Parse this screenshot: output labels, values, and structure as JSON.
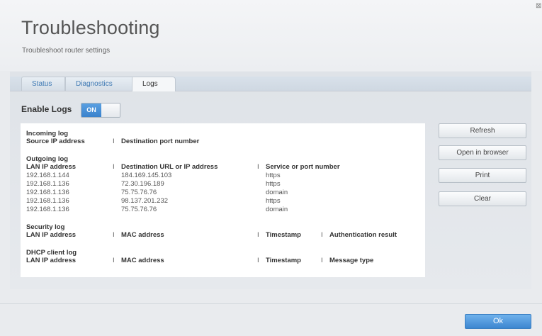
{
  "header": {
    "title": "Troubleshooting",
    "subtitle": "Troubleshoot router settings",
    "close_symbol": "⊠"
  },
  "tabs": [
    {
      "label": "Status"
    },
    {
      "label": "Diagnostics"
    },
    {
      "label": "Logs"
    }
  ],
  "enable_logs": {
    "label": "Enable Logs",
    "state": "ON"
  },
  "logs": {
    "sep": "I",
    "incoming": {
      "title": "Incoming log",
      "headers": [
        "Source IP address",
        "Destination port number"
      ]
    },
    "outgoing": {
      "title": "Outgoing log",
      "headers": [
        "LAN IP address",
        "Destination URL or IP address",
        "Service or port number"
      ],
      "rows": [
        [
          "192.168.1.144",
          "184.169.145.103",
          "https"
        ],
        [
          "192.168.1.136",
          "72.30.196.189",
          "https"
        ],
        [
          "192.168.1.136",
          "75.75.76.76",
          "domain"
        ],
        [
          "192.168.1.136",
          "98.137.201.232",
          "https"
        ],
        [
          "192.168.1.136",
          "75.75.76.76",
          "domain"
        ]
      ]
    },
    "security": {
      "title": "Security log",
      "headers": [
        "LAN IP address",
        "MAC address",
        "Timestamp",
        "Authentication result"
      ]
    },
    "dhcp": {
      "title": "DHCP client log",
      "headers": [
        "LAN IP address",
        "MAC address",
        "Timestamp",
        "Message type"
      ]
    }
  },
  "actions": {
    "refresh": "Refresh",
    "open_browser": "Open in browser",
    "print": "Print",
    "clear": "Clear"
  },
  "footer": {
    "ok": "Ok"
  },
  "colors": {
    "accent": "#3a82cc",
    "tab_link": "#3f7ab4"
  }
}
